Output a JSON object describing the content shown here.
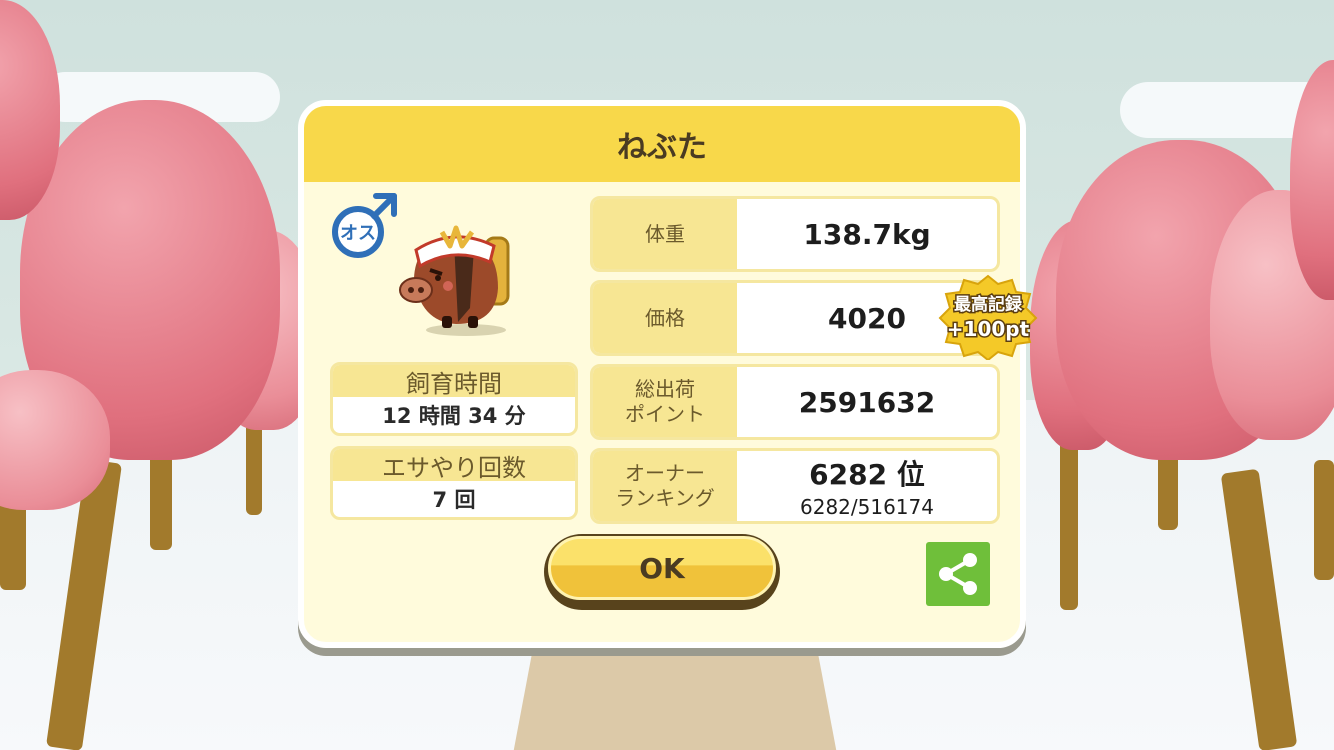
{
  "dialog": {
    "title": "ねぶた",
    "gender_badge": "オス",
    "rearing_time": {
      "label": "飼育時間",
      "value": "12 時間 34 分"
    },
    "feeding_count": {
      "label": "エサやり回数",
      "value": "7 回"
    },
    "stats": [
      {
        "label": "体重",
        "value": "138.7kg"
      },
      {
        "label": "価格",
        "value": "4020"
      },
      {
        "label": "総出荷\nポイント",
        "value": "2591632"
      },
      {
        "label": "オーナー\nランキング",
        "value": "6282 位",
        "sub": "6282/516174"
      }
    ],
    "record_badge": {
      "line1": "最高記録",
      "line2": "+100pt"
    },
    "ok_label": "OK"
  },
  "icons": {
    "gender": "male-symbol-icon",
    "character": "boar-character-icon",
    "share": "share-icon"
  },
  "colors": {
    "header": "#f8d84a",
    "panel": "#fffbdc",
    "label_bg": "#f7e693",
    "share": "#6fbf3a",
    "male_blue": "#2f6fb8"
  }
}
